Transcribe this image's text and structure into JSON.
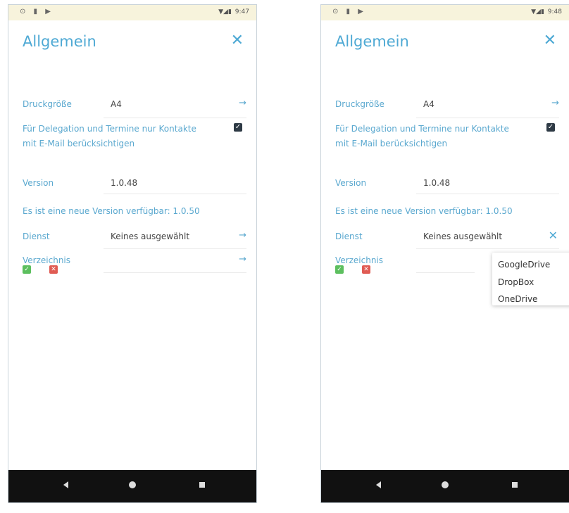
{
  "colors": {
    "accent": "#4ea9d4",
    "label": "#5aa8cf",
    "status_bar": "#f7f3dc",
    "nav_bar": "#111111",
    "ok": "#5cbf5e",
    "cancel": "#e05b53"
  },
  "left": {
    "status": {
      "icons": "⊙ ▮ ▶",
      "signal": "▼◢▮",
      "time": "9:47"
    },
    "title": "Allgemein",
    "close_glyph": "✕",
    "print_size": {
      "label": "Druckgröße",
      "value": "A4",
      "arrow": "→"
    },
    "delegation": {
      "text": "Für Delegation und Termine nur Kontakte mit E-Mail berücksichtigen",
      "checked": true
    },
    "version": {
      "label": "Version",
      "value": "1.0.48"
    },
    "update_notice": "Es ist eine neue Version verfügbar: 1.0.50",
    "service": {
      "label": "Dienst",
      "value": "Keines ausgewählt",
      "arrow": "→"
    },
    "directory": {
      "label": "Verzeichnis",
      "value": "",
      "arrow": "→"
    }
  },
  "right": {
    "status": {
      "icons": "⊙ ▮ ▶",
      "signal": "▼◢▮",
      "time": "9:48"
    },
    "title": "Allgemein",
    "close_glyph": "✕",
    "print_size": {
      "label": "Druckgröße",
      "value": "A4",
      "arrow": "→"
    },
    "delegation": {
      "text": "Für Delegation und Termine nur Kontakte mit E-Mail berücksichtigen",
      "checked": true
    },
    "version": {
      "label": "Version",
      "value": "1.0.48"
    },
    "update_notice": "Es ist eine neue Version verfügbar: 1.0.50",
    "service": {
      "label": "Dienst",
      "value": "Keines ausgewählt",
      "clear_glyph": "✕"
    },
    "directory": {
      "label": "Verzeichnis",
      "value": ""
    },
    "service_options": [
      "GoogleDrive",
      "DropBox",
      "OneDrive"
    ]
  }
}
